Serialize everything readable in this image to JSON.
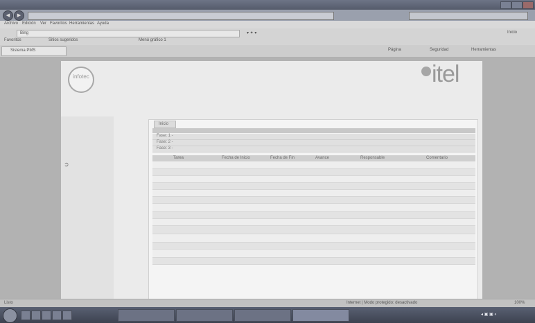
{
  "window": {
    "title": ""
  },
  "address": {
    "url": ""
  },
  "menu": {
    "items": [
      "Archivo",
      "Edición",
      "Ver",
      "Favoritos",
      "Herramientas",
      "Ayuda"
    ]
  },
  "command": {
    "bing": "Bing",
    "right": "Inicio",
    "favorites": "Favoritos",
    "suggested": "Sitios sugeridos",
    "menu": "Menú gráfico 1"
  },
  "tab": {
    "label": "Sistema PMS",
    "right": [
      "Página",
      "Seguridad",
      "Herramientas"
    ]
  },
  "page": {
    "header_line": "",
    "header_sub": "",
    "header_sub2": "",
    "brand_left": "infotec",
    "brand_right": "itel",
    "date_text": ""
  },
  "sidebar": {
    "items": [
      "",
      "",
      ""
    ]
  },
  "main": {
    "tab_label": "Inicio",
    "groups": [
      "Fase: 1 - ",
      "Fase: 2 - ",
      "Fase: 3 - "
    ],
    "columns": [
      "Tarea",
      "Fecha de Inicio",
      "Fecha de Fin",
      "Avance",
      "Responsable",
      "Comentario"
    ],
    "rows": [
      {
        "c": [
          "",
          "",
          "",
          "",
          "",
          ""
        ]
      },
      {
        "c": [
          "",
          "",
          "",
          "",
          "",
          ""
        ]
      },
      {
        "c": [
          "",
          "",
          "",
          "",
          "",
          ""
        ]
      },
      {
        "c": [
          "",
          "",
          "",
          "",
          "",
          ""
        ]
      },
      {
        "c": [
          "",
          "",
          "",
          "",
          "",
          ""
        ]
      },
      {
        "c": [
          "",
          "",
          "",
          "",
          "",
          ""
        ]
      },
      {
        "c": [
          "",
          "",
          "",
          "",
          "",
          ""
        ]
      },
      {
        "c": [
          "",
          "",
          "",
          "",
          "",
          ""
        ]
      },
      {
        "c": [
          "",
          "",
          "",
          "",
          "",
          ""
        ]
      },
      {
        "c": [
          "",
          "",
          "",
          "",
          "",
          ""
        ]
      },
      {
        "c": [
          "",
          "",
          "",
          "",
          "",
          ""
        ]
      },
      {
        "c": [
          "",
          "",
          "",
          "",
          "",
          ""
        ]
      },
      {
        "c": [
          "",
          "",
          "",
          "",
          "",
          ""
        ]
      },
      {
        "c": [
          "",
          "",
          "",
          "",
          "",
          ""
        ]
      }
    ],
    "footer": ""
  },
  "status": {
    "left": "Listo",
    "center": "Internet | Modo protegido: desactivado",
    "zoom": "100%"
  },
  "taskbar": {
    "buttons": [
      "",
      "",
      "",
      ""
    ]
  },
  "colors": {
    "chrome": "#6d7486",
    "page_bg": "#ebebeb",
    "taskbar": "#3d4250"
  }
}
